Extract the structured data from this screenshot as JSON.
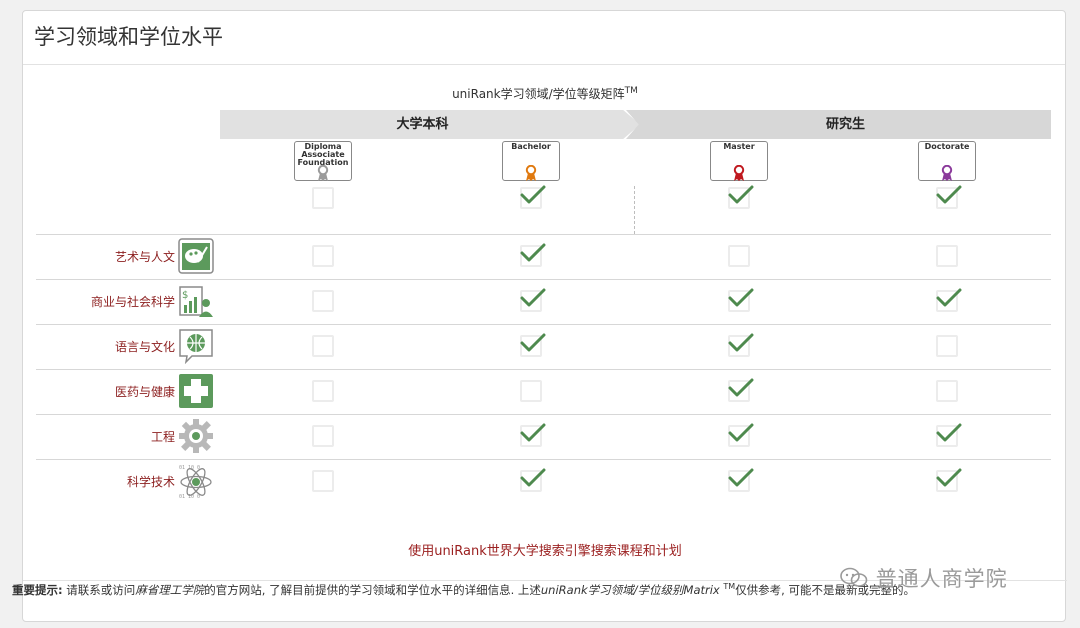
{
  "panel": {
    "title": "学习领域和学位水平"
  },
  "matrix": {
    "caption": "uniRank学习领域/学位等级矩阵",
    "caption_sup": "TM",
    "bands": {
      "undergraduate": "大学本科",
      "postgraduate": "研究生"
    },
    "degrees": [
      {
        "key": "diploma",
        "lines": [
          "Diploma",
          "Associate",
          "Foundation"
        ],
        "ribbon_color": "#9b9b9b"
      },
      {
        "key": "bachelor",
        "lines": [
          "Bachelor"
        ],
        "ribbon_color": "#e07a10"
      },
      {
        "key": "master",
        "lines": [
          "Master"
        ],
        "ribbon_color": "#c0191f"
      },
      {
        "key": "doctorate",
        "lines": [
          "Doctorate"
        ],
        "ribbon_color": "#8b3a9b"
      }
    ],
    "overall": [
      false,
      true,
      true,
      true
    ],
    "fields": [
      {
        "label": "艺术与人文",
        "icon": "palette-icon",
        "levels": [
          false,
          true,
          false,
          false
        ]
      },
      {
        "label": "商业与社会科学",
        "icon": "business-icon",
        "levels": [
          false,
          true,
          true,
          true
        ]
      },
      {
        "label": "语言与文化",
        "icon": "globe-speech-icon",
        "levels": [
          false,
          true,
          true,
          false
        ]
      },
      {
        "label": "医药与健康",
        "icon": "medical-cross-icon",
        "levels": [
          false,
          false,
          true,
          false
        ]
      },
      {
        "label": "工程",
        "icon": "gear-icon",
        "levels": [
          false,
          true,
          true,
          true
        ]
      },
      {
        "label": "科学技术",
        "icon": "atom-icon",
        "levels": [
          false,
          true,
          true,
          true
        ]
      }
    ]
  },
  "search_link": "使用uniRank世界大学搜索引擎搜索课程和计划",
  "note": {
    "prefix": "重要提示:",
    "text1": " 请联系或访问",
    "institution": "麻省理工学院",
    "text2": "的官方网站, 了解目前提供的学习领域和学位水平的详细信息. 上述",
    "matrix_ref": "uniRank学习领域/学位级别Matrix",
    "sup": "TM",
    "text3": "仅供参考, 可能不是最新或完整的。"
  },
  "watermark": "普通人商学院",
  "colors": {
    "tick": "#4e8a4e",
    "label": "#8c1f1f",
    "icon_bg": "#5c9a5c"
  }
}
